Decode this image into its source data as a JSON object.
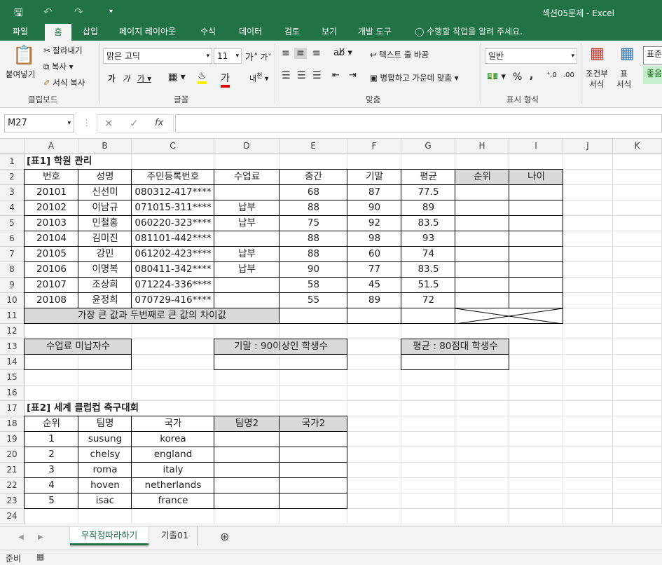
{
  "window": {
    "title": "섹션05문제 - Excel"
  },
  "menu_tabs": [
    "파일",
    "홈",
    "삽입",
    "페이지 레이아웃",
    "수식",
    "데이터",
    "검토",
    "보기",
    "개발 도구"
  ],
  "tell_me": "수행할 작업을 알려 주세요.",
  "ribbon": {
    "clipboard": {
      "paste": "붙여넣기",
      "cut": "잘라내기",
      "copy": "복사",
      "format_painter": "서식 복사",
      "label": "클립보드"
    },
    "font": {
      "name": "맑은 고딕",
      "size": "11",
      "label": "글꼴"
    },
    "align": {
      "wrap": "텍스트 줄 바꿈",
      "merge": "병합하고 가운데 맞춤",
      "label": "맞춤"
    },
    "number": {
      "format": "일반",
      "label": "표시 형식"
    },
    "styles": {
      "cond": "조건부\n서식",
      "table": "표\n서식",
      "label_a": "표준",
      "label_b": "좋음"
    }
  },
  "formula_bar": {
    "name_box": "M27",
    "formula": ""
  },
  "columns": [
    "A",
    "B",
    "C",
    "D",
    "E",
    "F",
    "G",
    "H",
    "I",
    "J",
    "K"
  ],
  "rows": [
    "1",
    "2",
    "3",
    "4",
    "5",
    "6",
    "7",
    "8",
    "9",
    "10",
    "11",
    "12",
    "13",
    "14",
    "15",
    "16",
    "17",
    "18",
    "19",
    "20",
    "21",
    "22",
    "23",
    "24"
  ],
  "cells": {
    "A1": "[표1] 학원 관리",
    "A2": "번호",
    "B2": "성명",
    "C2": "주민등록번호",
    "D2": "수업료",
    "E2": "중간",
    "F2": "기말",
    "G2": "평균",
    "H2": "순위",
    "I2": "나이",
    "A3": "20101",
    "B3": "신선미",
    "C3": "080312-417****",
    "D3": "",
    "E3": "68",
    "F3": "87",
    "G3": "77.5",
    "A4": "20102",
    "B4": "이남규",
    "C4": "071015-311****",
    "D4": "납부",
    "E4": "88",
    "F4": "90",
    "G4": "89",
    "A5": "20103",
    "B5": "민철홍",
    "C5": "060220-323****",
    "D5": "납부",
    "E5": "75",
    "F5": "92",
    "G5": "83.5",
    "A6": "20104",
    "B6": "김미진",
    "C6": "081101-442****",
    "D6": "",
    "E6": "88",
    "F6": "98",
    "G6": "93",
    "A7": "20105",
    "B7": "강민",
    "C7": "061202-423****",
    "D7": "납부",
    "E7": "88",
    "F7": "60",
    "G7": "74",
    "A8": "20106",
    "B8": "이명복",
    "C8": "080411-342****",
    "D8": "납부",
    "E8": "90",
    "F8": "77",
    "G8": "83.5",
    "A9": "20107",
    "B9": "조상희",
    "C9": "071224-336****",
    "D9": "",
    "E9": "58",
    "F9": "45",
    "G9": "51.5",
    "A10": "20108",
    "B10": "윤정희",
    "C10": "070729-416****",
    "D10": "",
    "E10": "55",
    "F10": "89",
    "G10": "72",
    "A11": "가장 큰 값과 두번째로 큰 값의 차이값",
    "A13": "수업료 미납자수",
    "D13": "기말 : 90이상인 학생수",
    "G13": "평균 : 80점대 학생수",
    "A17": "[표2] 세계 클럽컵 축구대회",
    "A18": "순위",
    "B18": "팀명",
    "C18": "국가",
    "D18": "팀명2",
    "E18": "국가2",
    "A19": "1",
    "B19": "susung",
    "C19": "korea",
    "A20": "2",
    "B20": "chelsy",
    "C20": "england",
    "A21": "3",
    "B21": "roma",
    "C21": "italy",
    "A22": "4",
    "B22": "hoven",
    "C22": "netherlands",
    "A23": "5",
    "B23": "isac",
    "C23": "france"
  },
  "sheet_tabs": [
    "무작정따라하기",
    "기출01"
  ],
  "status": {
    "ready": "준비"
  },
  "colors": {
    "excel_green": "#217346",
    "header_fill": "#d9d9d9"
  }
}
